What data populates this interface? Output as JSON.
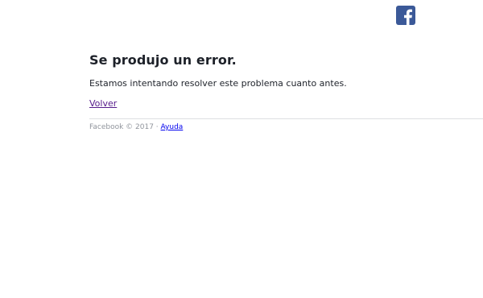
{
  "logo": {
    "icon": "facebook-f-icon",
    "color": "#3b5998"
  },
  "error": {
    "title": "Se produjo un error.",
    "message": "Estamos intentando resolver este problema cuanto antes.",
    "back_label": "Volver"
  },
  "footer": {
    "copyright": "Facebook © 2017",
    "separator": " · ",
    "help_label": "Ayuda"
  }
}
